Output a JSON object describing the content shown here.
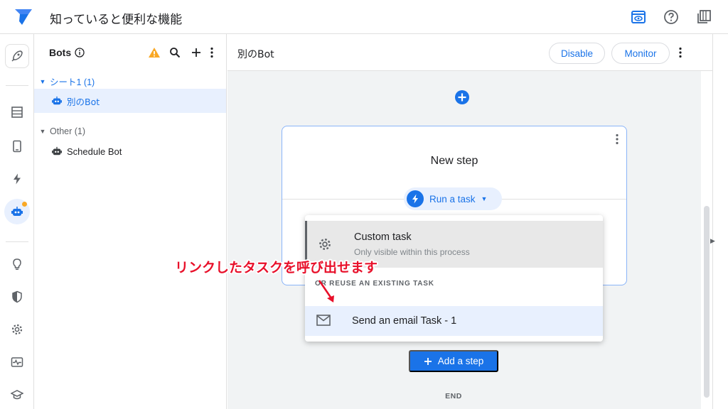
{
  "header": {
    "app_title": "知っていると便利な機能"
  },
  "bots_panel": {
    "title": "Bots",
    "groups": [
      {
        "label": "シート1 (1)",
        "bots": [
          "別のBot"
        ]
      },
      {
        "label": "Other (1)",
        "bots": [
          "Schedule Bot"
        ]
      }
    ]
  },
  "editor": {
    "title": "別のBot",
    "disable_label": "Disable",
    "monitor_label": "Monitor",
    "step": {
      "title": "New step",
      "run_task_label": "Run a task"
    },
    "dropdown": {
      "custom_task_title": "Custom task",
      "custom_task_sub": "Only visible within this process",
      "section_label": "OR REUSE AN EXISTING TASK",
      "email_task_label": "Send an email Task - 1"
    },
    "add_step_label": "Add a step",
    "end_label": "END"
  },
  "annotation": {
    "text": "リンクしたタスクを呼び出せます"
  },
  "colors": {
    "accent": "#1a73e8",
    "warning": "#f9a825",
    "annotation": "#e8102a"
  }
}
